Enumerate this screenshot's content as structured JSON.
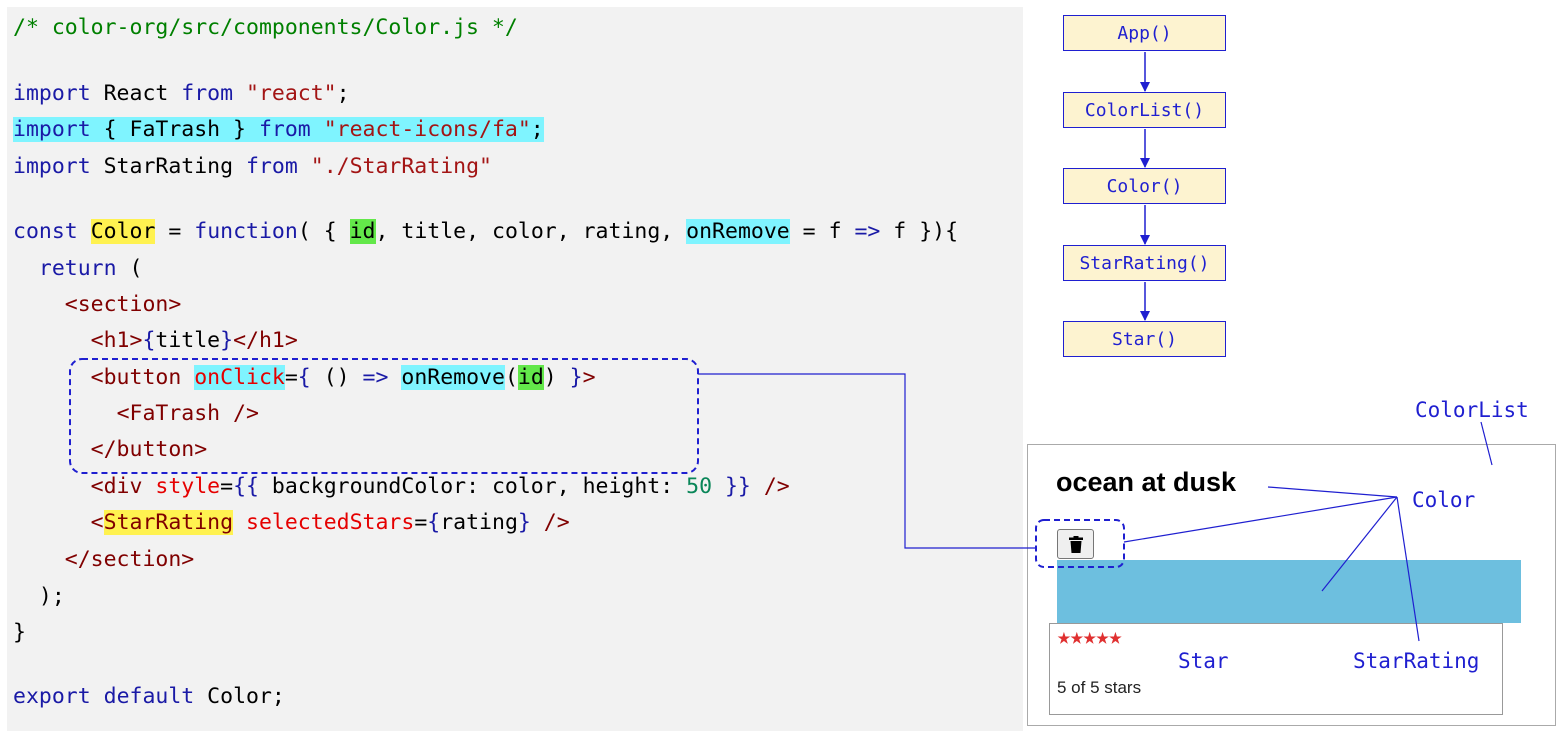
{
  "code": {
    "comment": "/* color-org/src/components/Color.js */",
    "l1": {
      "k1": "import",
      "p1": " React ",
      "k2": "from",
      "p2": " ",
      "s1": "\"react\"",
      "p3": ";"
    },
    "l2": {
      "k1": "import",
      "p1": " { FaTrash } ",
      "k2": "from",
      "p2": " ",
      "s1": "\"react-icons/fa\"",
      "p3": ";"
    },
    "l3": {
      "k1": "import",
      "p1": " StarRating ",
      "k2": "from",
      "p2": " ",
      "s1": "\"./StarRating\""
    },
    "l4": {
      "k1": "const",
      "p1": " ",
      "name": "Color",
      "p2": " = ",
      "k2": "function",
      "p3": "( { ",
      "id": "id",
      "p4": ", title, color, rating, ",
      "onRemove": "onRemove",
      "p5": " = f ",
      "arrow": "=>",
      "p6": " f }){"
    },
    "l5": {
      "indent": "  ",
      "k1": "return",
      "p1": " ("
    },
    "l6": {
      "indent": "    ",
      "t1": "<section>"
    },
    "l7": {
      "indent": "      ",
      "t1": "<h1>",
      "b1": "{",
      "p1": "title",
      "b2": "}",
      "t2": "</h1>"
    },
    "l8": {
      "indent": "      ",
      "t1": "<button",
      "p0": " ",
      "a1": "onClick",
      "p1": "=",
      "b1": "{",
      "p2": " () ",
      "arrow": "=>",
      "p3": " ",
      "onRemove": "onRemove",
      "p4": "(",
      "id": "id",
      "p5": ") ",
      "b2": "}",
      "t2": ">"
    },
    "l9": {
      "indent": "        ",
      "t1": "<FaTrash />"
    },
    "l10": {
      "indent": "      ",
      "t1": "</button>"
    },
    "l11": {
      "indent": "      ",
      "t1": "<div",
      "p0": " ",
      "a1": "style",
      "p1": "=",
      "b1": "{{",
      "p2": " backgroundColor: color, height: ",
      "n1": "50",
      "p3": " ",
      "b2": "}}",
      "t2": " />"
    },
    "l12": {
      "indent": "      ",
      "t1": "<",
      "name": "StarRating",
      "p0": " ",
      "a1": "selectedStars",
      "p1": "=",
      "b1": "{",
      "p2": "rating",
      "b2": "}",
      "t2": " />"
    },
    "l13": {
      "indent": "    ",
      "t1": "</section>"
    },
    "l14": {
      "p1": "  );"
    },
    "l15": {
      "p1": "}"
    },
    "l16": {
      "k1": "export",
      "p1": " ",
      "k2": "default",
      "p2": " Color;"
    }
  },
  "diagram": {
    "boxes": [
      "App()",
      "ColorList()",
      "Color()",
      "StarRating()",
      "Star()"
    ]
  },
  "preview": {
    "title": "ocean at dusk",
    "swatch_color": "#6dbfdf",
    "stars_filled": 5,
    "stars_total": 5,
    "stars_text": "5 of 5 stars"
  },
  "annotations": {
    "colorlist": "ColorList",
    "color": "Color",
    "star": "Star",
    "starrating": "StarRating"
  },
  "colors": {
    "accent": "#1f1fd0",
    "box_fill": "#fdf3d0",
    "star": "#e03030"
  }
}
